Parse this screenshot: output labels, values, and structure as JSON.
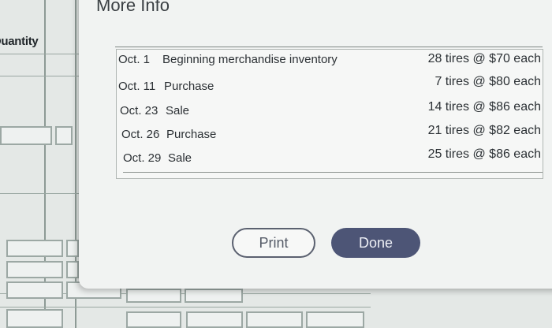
{
  "background": {
    "column_header": "Quantity"
  },
  "modal": {
    "title": "More Info",
    "rows": [
      {
        "date": "Oct. 1",
        "description": "Beginning merchandise inventory",
        "quantity": "28 tires @ $70 each"
      },
      {
        "date": "Oct. 11",
        "description": "Purchase",
        "quantity": "7 tires @ $80 each"
      },
      {
        "date": "Oct. 23",
        "description": "Sale",
        "quantity": "14 tires @ $86 each"
      },
      {
        "date": "Oct. 26",
        "description": "Purchase",
        "quantity": "21 tires @ $82 each"
      },
      {
        "date": "Oct. 29",
        "description": "Sale",
        "quantity": "25 tires @ $86 each"
      }
    ],
    "buttons": {
      "print": "Print",
      "done": "Done"
    }
  },
  "colors": {
    "done_button": "#4d5576",
    "print_border": "#5b6170"
  }
}
